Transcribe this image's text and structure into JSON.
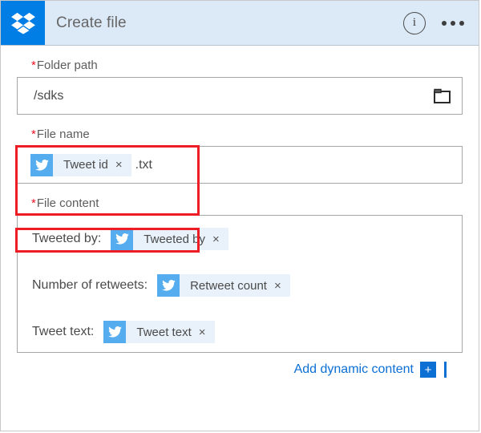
{
  "header": {
    "title": "Create file",
    "logo_icon": "dropbox-logo-icon",
    "logo_color": "#007ee5",
    "background_color": "#dceaf7",
    "info_icon": "info-icon",
    "info_glyph": "i",
    "more_icon": "more-options-icon"
  },
  "fields": {
    "folder_path": {
      "label": "Folder path",
      "required_marker": "*",
      "value": "/sdks",
      "picker_icon": "folder-icon"
    },
    "file_name": {
      "label": "File name",
      "required_marker": "*",
      "token": {
        "icon": "twitter-bird-icon",
        "label": "Tweet id",
        "remove": "×"
      },
      "suffix": ".txt"
    },
    "file_content": {
      "label": "File content",
      "required_marker": "*",
      "rows": [
        {
          "label": "Tweeted by:",
          "token": {
            "icon": "twitter-bird-icon",
            "label": "Tweeted by",
            "remove": "×"
          }
        },
        {
          "label": "Number of retweets:",
          "token": {
            "icon": "twitter-bird-icon",
            "label": "Retweet count",
            "remove": "×"
          }
        },
        {
          "label": "Tweet text:",
          "token": {
            "icon": "twitter-bird-icon",
            "label": "Tweet text",
            "remove": "×"
          }
        }
      ]
    }
  },
  "footer": {
    "add_dynamic_content": "Add dynamic content",
    "plus_label": "+",
    "link_color": "#0b6fd4"
  },
  "annotations": {
    "color": "#ee1c25",
    "boxes": [
      "file-name-highlight",
      "file-content-highlight"
    ]
  }
}
